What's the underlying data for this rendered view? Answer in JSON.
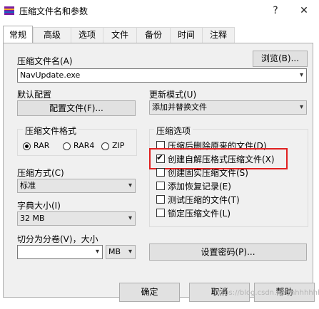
{
  "window": {
    "title": "压缩文件名和参数",
    "help_btn": "?",
    "close_btn": "✕"
  },
  "tabs": [
    "常规",
    "高级",
    "选项",
    "文件",
    "备份",
    "时间",
    "注释"
  ],
  "archive": {
    "label": "压缩文件名(A)",
    "value": "NavUpdate.exe",
    "browse": "浏览(B)..."
  },
  "profile": {
    "label": "默认配置",
    "button": "配置文件(F)..."
  },
  "update_mode": {
    "label": "更新模式(U)",
    "value": "添加并替换文件"
  },
  "format": {
    "label": "压缩文件格式",
    "options": [
      "RAR",
      "RAR4",
      "ZIP"
    ],
    "selected": "RAR"
  },
  "method": {
    "label": "压缩方式(C)",
    "value": "标准"
  },
  "dict": {
    "label": "字典大小(I)",
    "value": "32 MB"
  },
  "split": {
    "label": "切分为分卷(V)，大小",
    "value": "",
    "unit": "MB"
  },
  "options": {
    "label": "压缩选项",
    "items": [
      {
        "label": "压缩后删除原来的文件(D)",
        "checked": false
      },
      {
        "label": "创建自解压格式压缩文件(X)",
        "checked": true
      },
      {
        "label": "创建固实压缩文件(S)",
        "checked": false
      },
      {
        "label": "添加恢复记录(E)",
        "checked": false
      },
      {
        "label": "测试压缩的文件(T)",
        "checked": false
      },
      {
        "label": "锁定压缩文件(L)",
        "checked": false
      }
    ]
  },
  "password_btn": "设置密码(P)...",
  "footer": {
    "ok": "确定",
    "cancel": "取消",
    "help": "帮助"
  },
  "watermark": "https://blog.csdn.net/hhhhhhhh",
  "colors": {
    "highlight": "#e02020",
    "window_bg": "#f0f0f0"
  }
}
